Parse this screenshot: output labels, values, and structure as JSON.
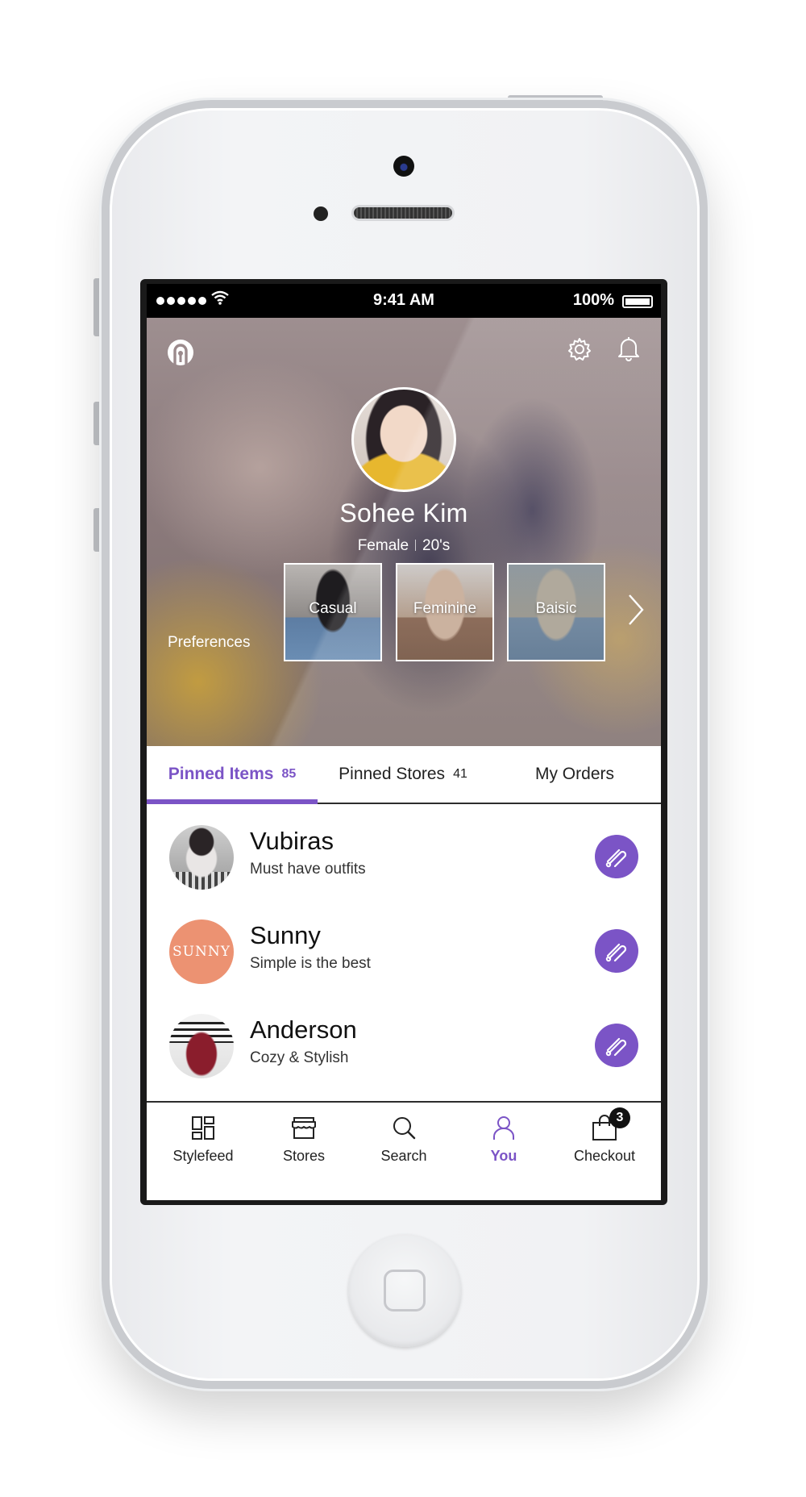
{
  "status_bar": {
    "time": "9:41 AM",
    "battery": "100%"
  },
  "profile": {
    "name": "Sohee Kim",
    "gender": "Female",
    "age_group": "20's",
    "preferences_label": "Preferences",
    "preferences": [
      "Casual",
      "Feminine",
      "Baisic"
    ]
  },
  "tabs": [
    {
      "label": "Pinned Items",
      "count": "85",
      "active": true
    },
    {
      "label": "Pinned Stores",
      "count": "41",
      "active": false
    },
    {
      "label": "My Orders",
      "count": "",
      "active": false
    }
  ],
  "pinned": [
    {
      "title": "Vubiras",
      "subtitle": "Must have outfits"
    },
    {
      "title": "Sunny",
      "subtitle": "Simple is the best",
      "logo_text": "SUNNY"
    },
    {
      "title": "Anderson",
      "subtitle": "Cozy & Stylish"
    }
  ],
  "nav": [
    {
      "label": "Stylefeed",
      "icon": "stylefeed-icon"
    },
    {
      "label": "Stores",
      "icon": "store-icon"
    },
    {
      "label": "Search",
      "icon": "search-icon"
    },
    {
      "label": "You",
      "icon": "user-icon",
      "active": true
    },
    {
      "label": "Checkout",
      "icon": "shopping-bag-icon",
      "badge": "3"
    }
  ],
  "colors": {
    "accent": "#7b54c6",
    "sunny_logo": "#ec9272"
  }
}
